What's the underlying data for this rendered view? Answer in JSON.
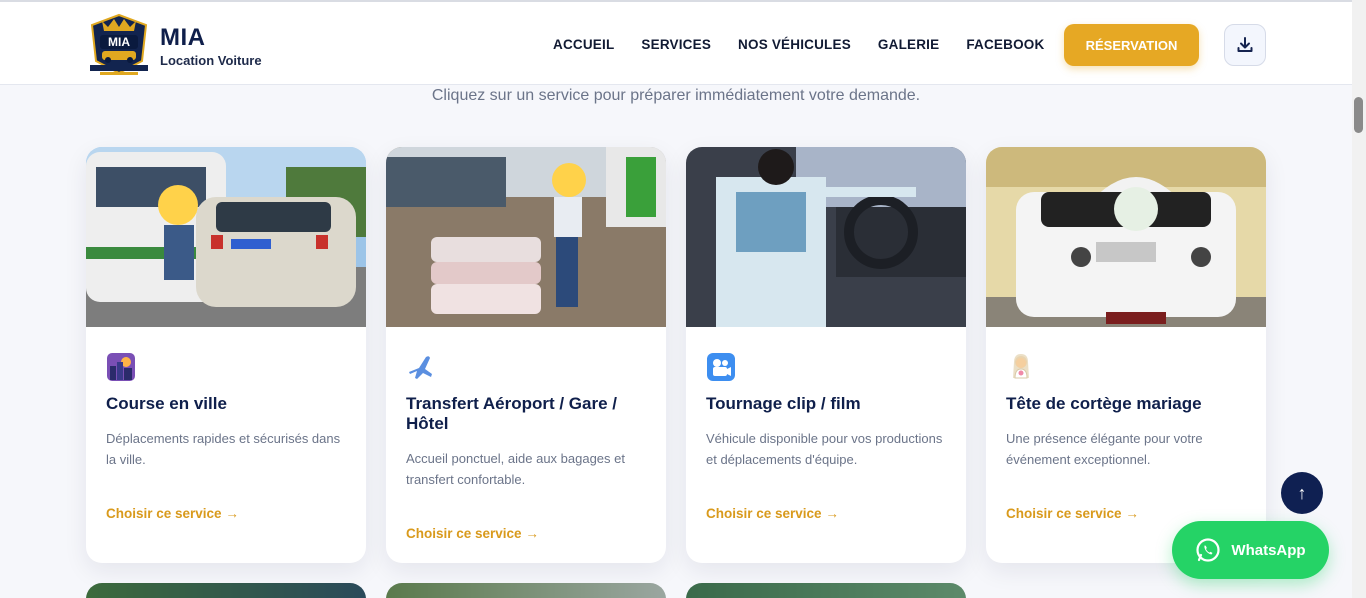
{
  "brand": {
    "name": "MIA",
    "subtitle": "Location Voiture"
  },
  "nav": {
    "items": [
      "ACCUEIL",
      "SERVICES",
      "NOS VÉHICULES",
      "GALERIE",
      "FACEBOOK"
    ]
  },
  "header": {
    "reserve_label": "RÉSERVATION",
    "download_icon": "download-icon"
  },
  "intro": {
    "text": "Cliquez sur un service pour préparer immédiatement votre demande."
  },
  "services": [
    {
      "icon": "city-icon",
      "title": "Course en ville",
      "description": "Déplacements rapides et sécurisés dans la ville.",
      "link": "Choisir ce service →"
    },
    {
      "icon": "airplane-icon",
      "title": "Transfert Aéroport / Gare / Hôtel",
      "description": "Accueil ponctuel, aide aux bagages et transfert confortable.",
      "link": "Choisir ce service →"
    },
    {
      "icon": "camera-icon",
      "title": "Tournage clip / film",
      "description": "Véhicule disponible pour vos productions et déplacements d'équipe.",
      "link": "Choisir ce service →"
    },
    {
      "icon": "bride-icon",
      "title": "Tête de cortège mariage",
      "description": "Une présence élégante pour votre événement exceptionnel.",
      "link": "Choisir ce service →"
    }
  ],
  "floating": {
    "top_arrow": "↑",
    "whatsapp_label": "WhatsApp"
  },
  "colors": {
    "accent": "#e6a824",
    "navy": "#0f1f4b",
    "whatsapp": "#25d366",
    "link": "#d99a1c"
  }
}
